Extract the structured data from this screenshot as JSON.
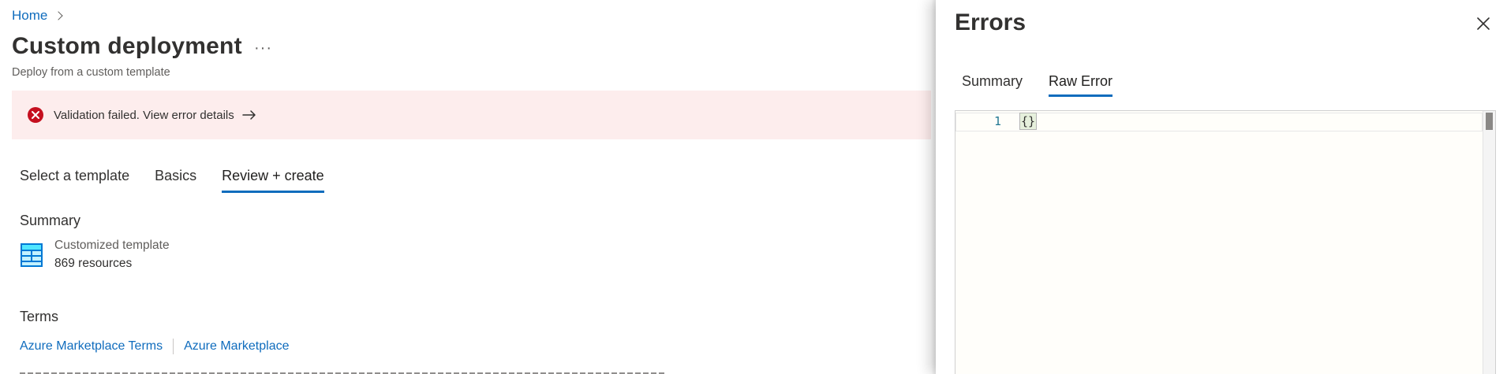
{
  "breadcrumb": {
    "home": "Home"
  },
  "page": {
    "title": "Custom deployment",
    "more": "···",
    "subtitle": "Deploy from a custom template"
  },
  "alert": {
    "message": "Validation failed. View error details"
  },
  "steps": [
    {
      "label": "Select a template"
    },
    {
      "label": "Basics"
    },
    {
      "label": "Review + create",
      "active": true
    }
  ],
  "summary": {
    "heading": "Summary",
    "template_name": "Customized template",
    "resources": "869 resources"
  },
  "terms": {
    "heading": "Terms",
    "links": [
      "Azure Marketplace Terms",
      "Azure Marketplace"
    ]
  },
  "errors_panel": {
    "title": "Errors",
    "tabs": [
      {
        "label": "Summary"
      },
      {
        "label": "Raw Error",
        "active": true
      }
    ],
    "editor": {
      "line_number": "1",
      "code": "{}"
    }
  },
  "colors": {
    "accent": "#0f6cbd",
    "alert_bg": "#fdeded",
    "error_red": "#c50f1f"
  },
  "icons": [
    "chevron-right-icon",
    "more-icon",
    "error-icon",
    "arrow-right-icon",
    "template-icon",
    "close-icon"
  ]
}
